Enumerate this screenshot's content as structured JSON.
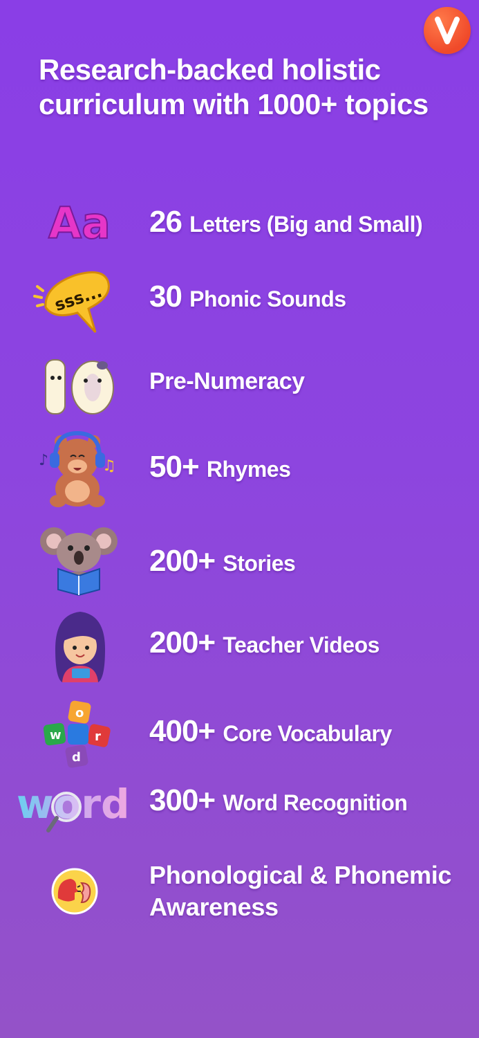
{
  "header": {
    "brand_logo": "v-brand-logo",
    "title_line1": "Research-backed holistic",
    "title_line2": "curriculum with 1000+ topics"
  },
  "colors": {
    "background_top": "#8a3ee6",
    "background_bottom": "#9452c8",
    "logo": "#f04a2a",
    "text": "#ffffff"
  },
  "topics": [
    {
      "icon": "letters-aa-icon",
      "count": "26",
      "label": "Letters (Big and Small)"
    },
    {
      "icon": "speech-bubble-sss-icon",
      "count": "30",
      "label": "Phonic Sounds"
    },
    {
      "icon": "number-ten-icon",
      "count": "",
      "label": "Pre-Numeracy"
    },
    {
      "icon": "bear-headphones-icon",
      "count": "50+",
      "label": "Rhymes"
    },
    {
      "icon": "koala-reading-icon",
      "count": "200+",
      "label": "Stories"
    },
    {
      "icon": "teacher-girl-icon",
      "count": "200+",
      "label": "Teacher Videos"
    },
    {
      "icon": "word-puzzle-icon",
      "count": "400+",
      "label": "Core Vocabulary"
    },
    {
      "icon": "word-magnifier-icon",
      "count": "300+",
      "label": "Word Recognition"
    },
    {
      "icon": "speaking-ear-icon",
      "count": "",
      "label_line1": "Phonological & Phonemic",
      "label_line2": "Awareness"
    }
  ],
  "icon_texts": {
    "letters": "Aa",
    "bubble": "sss...",
    "ten": "10",
    "puzzle_letters": [
      "w",
      "o",
      "r",
      "d"
    ],
    "word_logo": "word"
  }
}
